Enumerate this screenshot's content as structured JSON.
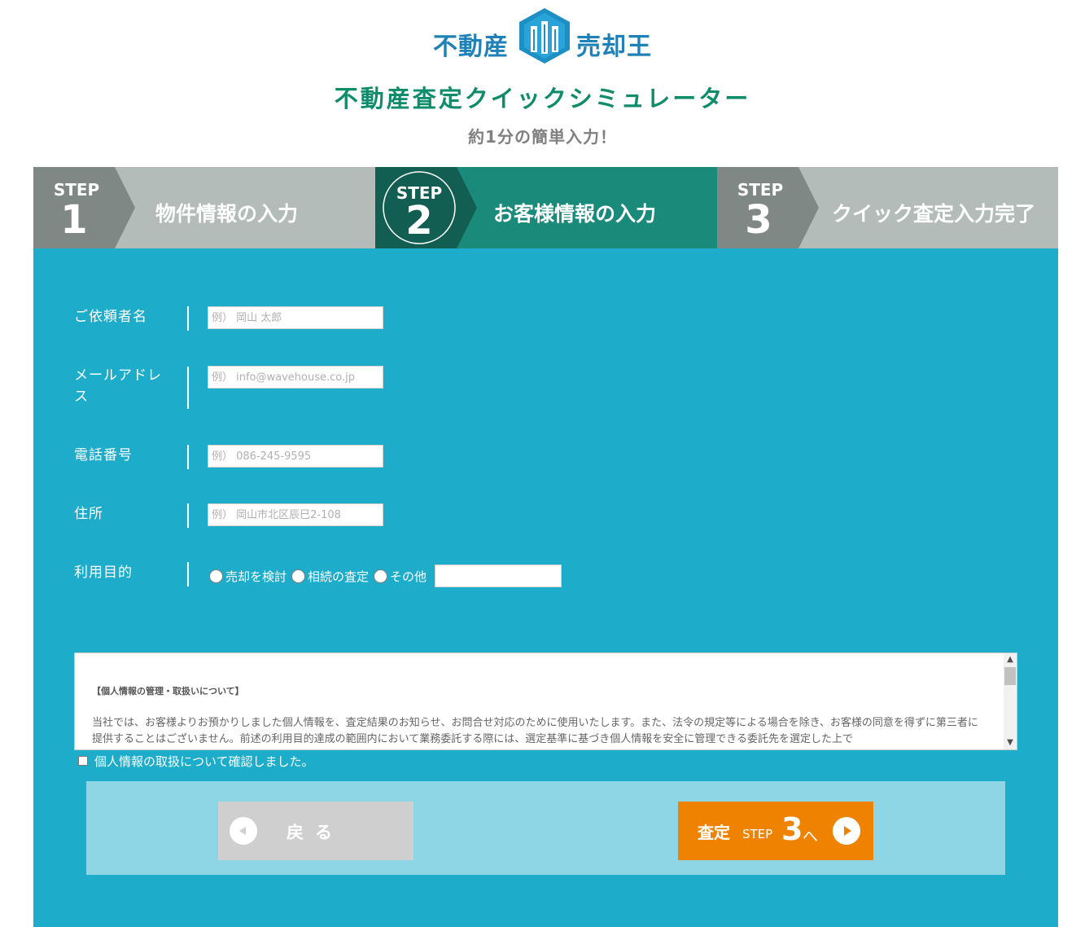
{
  "logo": {
    "left": "不動産",
    "right": "売却王"
  },
  "header": {
    "title": "不動産査定クイックシミュレーター",
    "subtitle": "約1分の簡単入力！"
  },
  "steps": [
    {
      "label": "STEP",
      "number": "1",
      "text": "物件情報の入力",
      "state": "done"
    },
    {
      "label": "STEP",
      "number": "2",
      "text": "お客様情報の入力",
      "state": "active"
    },
    {
      "label": "STEP",
      "number": "3",
      "text": "クイック査定入力完了",
      "state": "pending"
    }
  ],
  "form": {
    "name": {
      "label": "ご依頼者名",
      "placeholder": "例） 岡山 太郎"
    },
    "email": {
      "label": "メールアドレス",
      "placeholder": "例） info@wavehouse.co.jp"
    },
    "phone": {
      "label": "電話番号",
      "placeholder": "例） 086-245-9595"
    },
    "address": {
      "label": "住所",
      "placeholder": "例） 岡山市北区辰巳2-108"
    },
    "purpose": {
      "label": "利用目的",
      "options": [
        "売却を検討",
        "相続の査定",
        "その他"
      ]
    }
  },
  "policy": {
    "title": "【個人情報の管理・取扱いについて】",
    "body": "当社では、お客様よりお預かりしました個人情報を、査定結果のお知らせ、お問合せ対応のために使用いたします。また、法令の規定等による場合を除き、お客様の同意を得ずに第三者に提供することはございません。前述の利用目的達成の範囲内において業務委託する際には、選定基準に基づき個人情報を安全に管理できる委託先を選定した上で"
  },
  "agree": {
    "label": "個人情報の取扱について確認しました。"
  },
  "buttons": {
    "back": "戻る",
    "next_prefix": "査定",
    "next_step": "STEP",
    "next_number": "3",
    "next_suffix": "へ"
  },
  "colors": {
    "brand_blue": "#1e82b8",
    "title_green": "#0f8c6a",
    "form_bg": "#1eaccb",
    "step_active": "#1a8a7b",
    "step_active_dark": "#125e52",
    "step_inactive": "#b4bcba",
    "step_inactive_dark": "#808886",
    "next_button": "#ef8300",
    "back_button": "#cfcfcf"
  }
}
